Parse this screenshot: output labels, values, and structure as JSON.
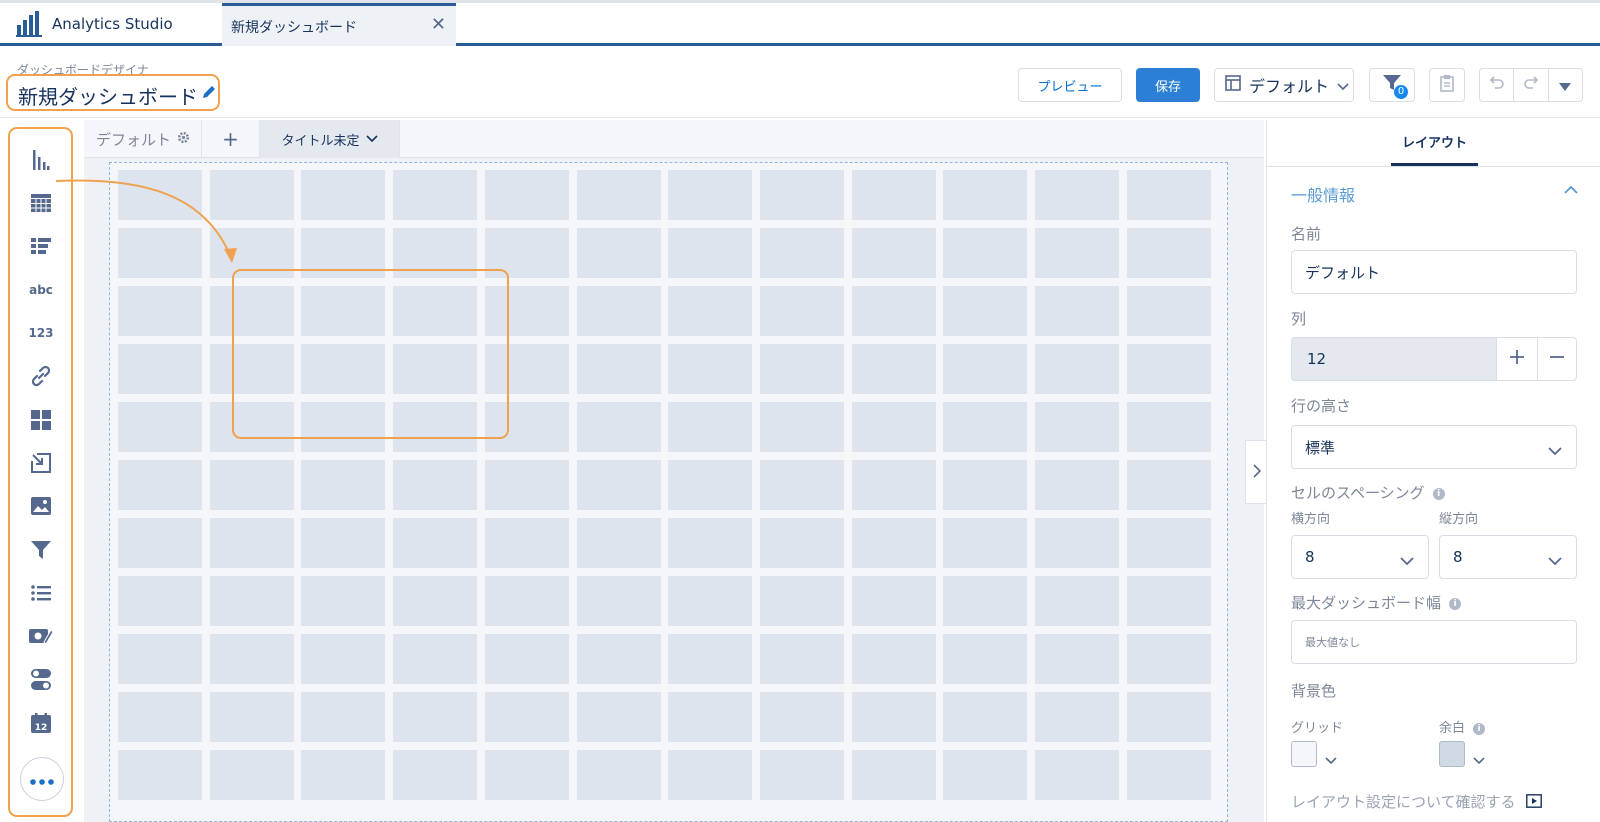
{
  "app": {
    "title": "Analytics Studio",
    "tab_label": "新規ダッシュボード",
    "tab_close": "✕"
  },
  "header": {
    "subtitle": "ダッシュボードデザイナ",
    "title": "新規ダッシュボード",
    "preview_label": "プレビュー",
    "save_label": "保存",
    "layout_label": "デフォルト",
    "filter_count": "0"
  },
  "canvas": {
    "default_tab": "デフォルト",
    "add_tab": "+",
    "untitled_tab": "タイトル未定",
    "columns": 12,
    "rows": 11
  },
  "palette": {
    "items": [
      "chart-widget",
      "table-widget",
      "list-widget",
      "text-widget",
      "number-widget",
      "link-widget",
      "container-widget",
      "navigation-widget",
      "image-widget",
      "filter-widget",
      "list-selector-widget",
      "date-selector-widget",
      "toggle-widget",
      "calendar-widget"
    ],
    "text_icon": "abc",
    "number_icon": "123",
    "calendar_day": "12"
  },
  "panel": {
    "tab": "レイアウト",
    "section_title": "一般情報",
    "name_label": "名前",
    "name_value": "デフォルト",
    "columns_label": "列",
    "columns_value": "12",
    "row_height_label": "行の高さ",
    "row_height_value": "標準",
    "cell_spacing_label": "セルのスペーシング",
    "horizontal_label": "横方向",
    "horizontal_value": "8",
    "vertical_label": "縦方向",
    "vertical_value": "8",
    "max_width_label": "最大ダッシュボード幅",
    "max_width_placeholder": "最大値なし",
    "bg_color_label": "背景色",
    "grid_label": "グリッド",
    "margin_label": "余白",
    "learn_more": "レイアウト設定について確認する",
    "grid_color": "#f4f6f9",
    "margin_color": "#cfd8e3"
  },
  "colors": {
    "accent": "#2b7fd4",
    "highlight": "#f0a14e",
    "navy": "#2a5d95"
  }
}
